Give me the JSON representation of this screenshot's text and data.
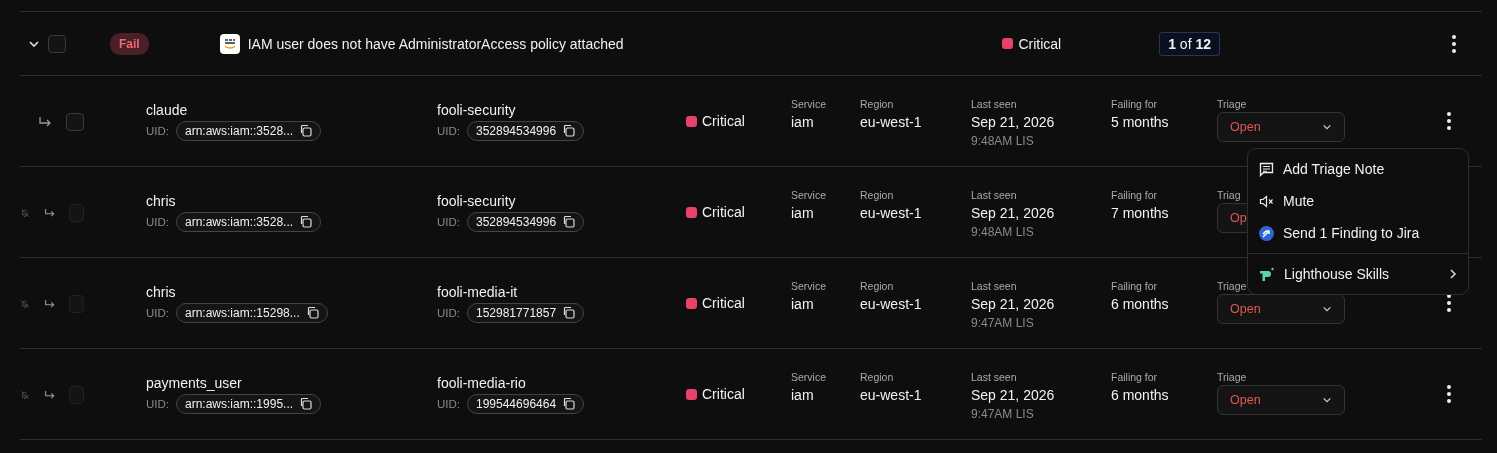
{
  "finding": {
    "expanded": true,
    "checked": false,
    "status": "Fail",
    "title": "IAM user does not have AdministratorAccess policy attached",
    "severity": "Critical",
    "count_current": "1",
    "count_of": "of",
    "count_total": "12"
  },
  "resources": [
    {
      "muted": false,
      "checked": false,
      "disabled": false,
      "name": "claude",
      "uid_label": "UID:",
      "uid": "arn:aws:iam::3528...",
      "account": "fooli-security",
      "account_uid_label": "UID:",
      "account_uid": "352894534996",
      "severity": "Critical",
      "service_label": "Service",
      "service": "iam",
      "region_label": "Region",
      "region": "eu-west-1",
      "last_seen_label": "Last seen",
      "last_seen_date": "Sep 21, 2026",
      "last_seen_time": "9:48AM LIS",
      "failing_label": "Failing for",
      "failing": "5 months",
      "triage_label": "Triage",
      "triage": "Open",
      "more_button": true
    },
    {
      "muted": true,
      "checked": false,
      "disabled": true,
      "name": "chris",
      "uid_label": "UID:",
      "uid": "arn:aws:iam::3528...",
      "account": "fooli-security",
      "account_uid_label": "UID:",
      "account_uid": "352894534996",
      "severity": "Critical",
      "service_label": "Service",
      "service": "iam",
      "region_label": "Region",
      "region": "eu-west-1",
      "last_seen_label": "Last seen",
      "last_seen_date": "Sep 21, 2026",
      "last_seen_time": "9:48AM LIS",
      "failing_label": "Failing for",
      "failing": "7 months",
      "triage_label": "Triag",
      "triage": "Op",
      "more_button": false
    },
    {
      "muted": true,
      "checked": false,
      "disabled": true,
      "name": "chris",
      "uid_label": "UID:",
      "uid": "arn:aws:iam::15298...",
      "account": "fooli-media-it",
      "account_uid_label": "UID:",
      "account_uid": "152981771857",
      "severity": "Critical",
      "service_label": "Service",
      "service": "iam",
      "region_label": "Region",
      "region": "eu-west-1",
      "last_seen_label": "Last seen",
      "last_seen_date": "Sep 21, 2026",
      "last_seen_time": "9:47AM LIS",
      "failing_label": "Failing for",
      "failing": "6 months",
      "triage_label": "Triage",
      "triage": "Open",
      "more_button": true
    },
    {
      "muted": true,
      "checked": false,
      "disabled": true,
      "name": "payments_user",
      "uid_label": "UID:",
      "uid": "arn:aws:iam::1995...",
      "account": "fooli-media-rio",
      "account_uid_label": "UID:",
      "account_uid": "199544696464",
      "severity": "Critical",
      "service_label": "Service",
      "service": "iam",
      "region_label": "Region",
      "region": "eu-west-1",
      "last_seen_label": "Last seen",
      "last_seen_date": "Sep 21, 2026",
      "last_seen_time": "9:47AM LIS",
      "failing_label": "Failing for",
      "failing": "6 months",
      "triage_label": "Triage",
      "triage": "Open",
      "more_button": true
    }
  ],
  "menu": {
    "items": [
      {
        "kind": "note",
        "label": "Add Triage Note"
      },
      {
        "kind": "mute",
        "label": "Mute"
      },
      {
        "kind": "jira",
        "label": "Send 1 Finding to Jira"
      },
      {
        "kind": "skills",
        "label": "Lighthouse Skills",
        "submenu": true
      }
    ]
  }
}
